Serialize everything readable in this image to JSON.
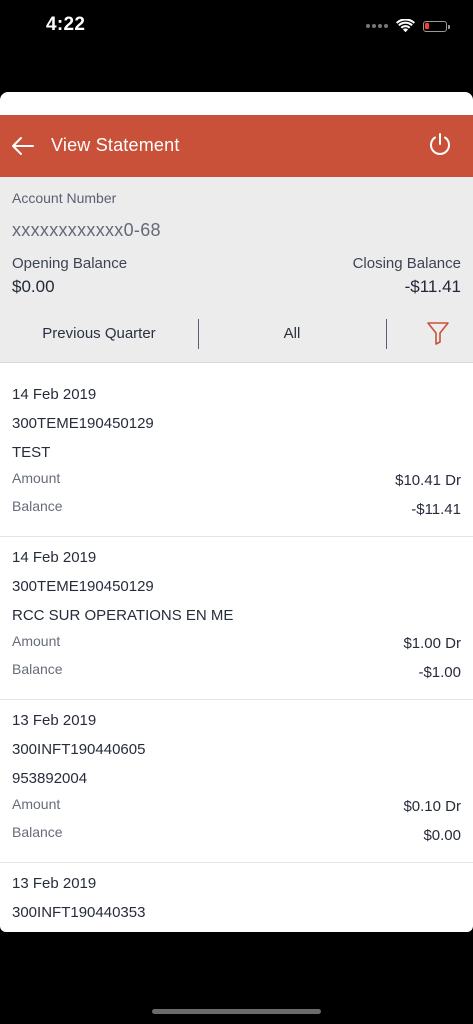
{
  "status_bar": {
    "time": "4:22",
    "battery_color": "#ff3b30"
  },
  "header": {
    "title": "View Statement",
    "back_icon": "arrow-left-icon",
    "power_icon": "power-icon",
    "background": "#c9513a"
  },
  "account": {
    "label": "Account Number",
    "number": "xxxxxxxxxxxx0-68",
    "opening_label": "Opening Balance",
    "opening_value": "$0.00",
    "closing_label": "Closing Balance",
    "closing_value": "-$11.41"
  },
  "filters": {
    "period": "Previous Quarter",
    "type": "All",
    "filter_icon": "funnel-icon",
    "accent": "#c9513a"
  },
  "transactions": [
    {
      "date": "14 Feb 2019",
      "reference": "300TEME190450129",
      "description": "TEST",
      "amount_label": "Amount",
      "amount": "$10.41 Dr",
      "balance_label": "Balance",
      "balance": "-$11.41"
    },
    {
      "date": "14 Feb 2019",
      "reference": "300TEME190450129",
      "description": "RCC SUR OPERATIONS EN ME",
      "amount_label": "Amount",
      "amount": "$1.00 Dr",
      "balance_label": "Balance",
      "balance": "-$1.00"
    },
    {
      "date": "13 Feb 2019",
      "reference": "300INFT190440605",
      "description": "953892004",
      "amount_label": "Amount",
      "amount": "$0.10 Dr",
      "balance_label": "Balance",
      "balance": "$0.00"
    },
    {
      "date": "13 Feb 2019",
      "reference": "300INFT190440353"
    }
  ]
}
